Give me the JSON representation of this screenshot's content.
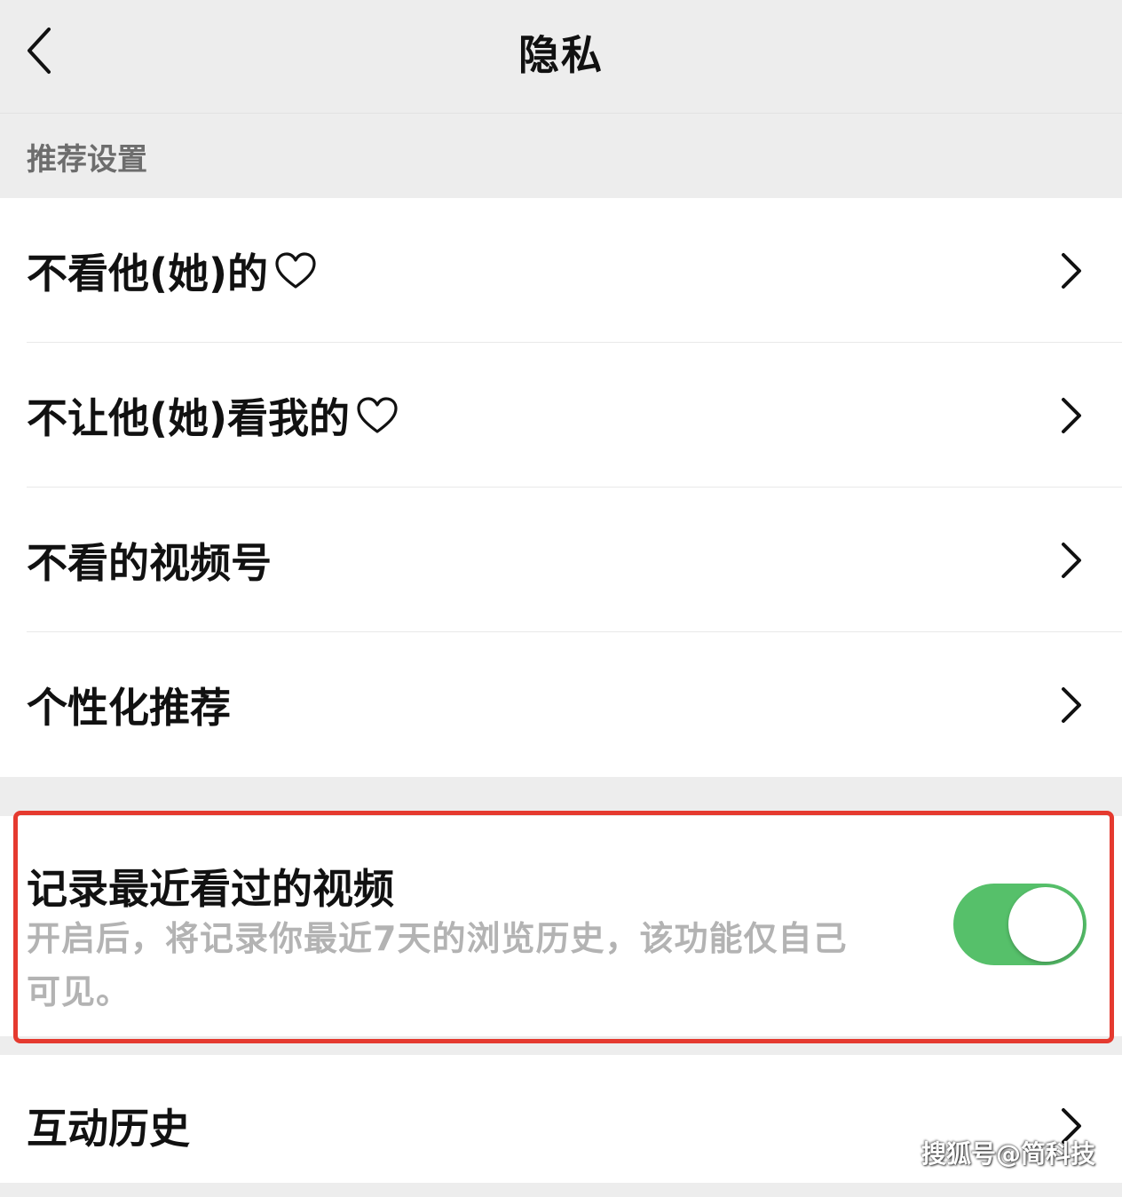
{
  "navbar": {
    "title": "隐私",
    "back_icon": "chevron-left-icon"
  },
  "section": {
    "header": "推荐设置"
  },
  "recommend_items": [
    {
      "label": "不看他(她)的",
      "has_heart": true
    },
    {
      "label": "不让他(她)看我的",
      "has_heart": true
    },
    {
      "label": "不看的视频号",
      "has_heart": false
    },
    {
      "label": "个性化推荐",
      "has_heart": false
    }
  ],
  "record_setting": {
    "title": "记录最近看过的视频",
    "description": "开启后，将记录你最近7天的浏览历史，该功能仅自己可见。",
    "enabled": true
  },
  "history_item": {
    "label": "互动历史"
  },
  "watermark": "搜狐号@简科技",
  "colors": {
    "background": "#ededed",
    "toggle_on": "#56c06a",
    "highlight_border": "#e53a2f",
    "secondary_text": "#b3b3b3"
  }
}
